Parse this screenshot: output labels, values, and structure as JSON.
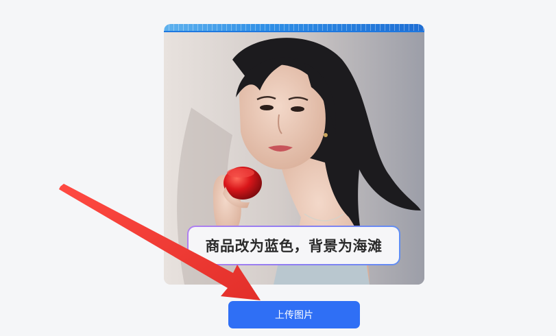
{
  "prompt": {
    "text": "商品改为蓝色，背景为海滩"
  },
  "upload_button": {
    "label": "上传图片"
  },
  "colors": {
    "page_background": "#f5f6f8",
    "primary_button": "#2f6ff5",
    "arrow": "#f03b34",
    "prompt_border_start": "#b07ff0",
    "prompt_border_end": "#5f8df3"
  },
  "icons": {
    "annotation_arrow": "red-arrow-icon"
  }
}
